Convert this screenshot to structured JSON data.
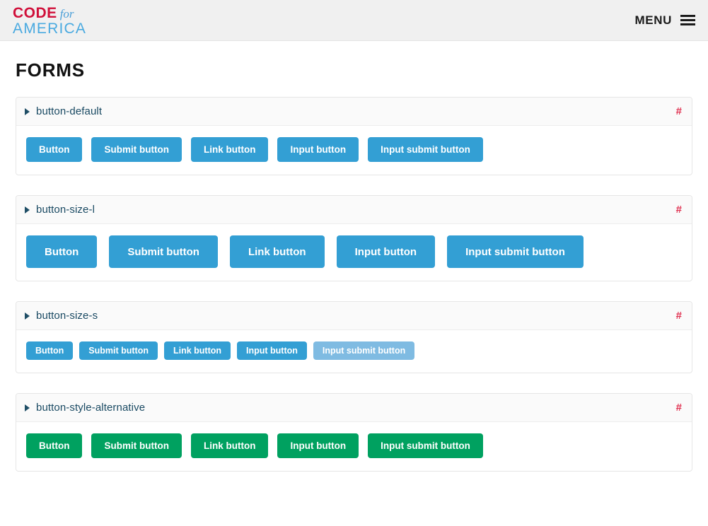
{
  "header": {
    "logo": {
      "line1_primary": "CODE",
      "line1_secondary": "for",
      "line2": "AMERICA",
      "color_primary": "#d0103a",
      "color_secondary": "#4aaae0"
    },
    "menu": {
      "label": "MENU",
      "icon": "hamburger-icon"
    }
  },
  "page": {
    "title": "FORMS"
  },
  "panels": [
    {
      "title": "button-default",
      "anchor": "#",
      "size": "default",
      "style": "primary",
      "buttons": [
        {
          "label": "Button"
        },
        {
          "label": "Submit button"
        },
        {
          "label": "Link button"
        },
        {
          "label": "Input button"
        },
        {
          "label": "Input submit button"
        }
      ]
    },
    {
      "title": "button-size-l",
      "anchor": "#",
      "size": "l",
      "style": "primary",
      "buttons": [
        {
          "label": "Button"
        },
        {
          "label": "Submit button"
        },
        {
          "label": "Link button"
        },
        {
          "label": "Input button"
        },
        {
          "label": "Input submit button"
        }
      ]
    },
    {
      "title": "button-size-s",
      "anchor": "#",
      "size": "s",
      "style": "primary",
      "buttons": [
        {
          "label": "Button"
        },
        {
          "label": "Submit button"
        },
        {
          "label": "Link button"
        },
        {
          "label": "Input button"
        },
        {
          "label": "Input submit button",
          "state": "muted"
        }
      ]
    },
    {
      "title": "button-style-alternative",
      "anchor": "#",
      "size": "default",
      "style": "alternative",
      "buttons": [
        {
          "label": "Button"
        },
        {
          "label": "Submit button"
        },
        {
          "label": "Link button"
        },
        {
          "label": "Input button"
        },
        {
          "label": "Input submit button"
        }
      ]
    }
  ],
  "colors": {
    "button_primary": "#339fd4",
    "button_primary_muted": "#7fbbe2",
    "button_alternative": "#00a160",
    "anchor_hash": "#e03050",
    "panel_title": "#1a4a63",
    "header_background": "#f0f0f0"
  }
}
